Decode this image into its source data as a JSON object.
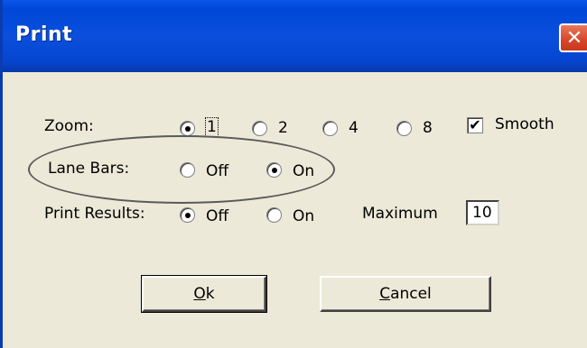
{
  "window": {
    "title": "Print"
  },
  "zoom": {
    "label": "Zoom:",
    "options": [
      "1",
      "2",
      "4",
      "8"
    ],
    "selected": "1"
  },
  "smooth": {
    "label": "Smooth",
    "checked": true
  },
  "lane_bars": {
    "label": "Lane Bars:",
    "options": [
      "Off",
      "On"
    ],
    "selected": "On"
  },
  "print_results": {
    "label": "Print Results:",
    "options": [
      "Off",
      "On"
    ],
    "selected": "Off"
  },
  "maximum": {
    "label": "Maximum",
    "value": "10"
  },
  "buttons": {
    "ok_prefix": "",
    "ok_mnemonic": "O",
    "ok_rest": "k",
    "cancel_prefix": "",
    "cancel_mnemonic": "C",
    "cancel_rest": "ancel"
  }
}
